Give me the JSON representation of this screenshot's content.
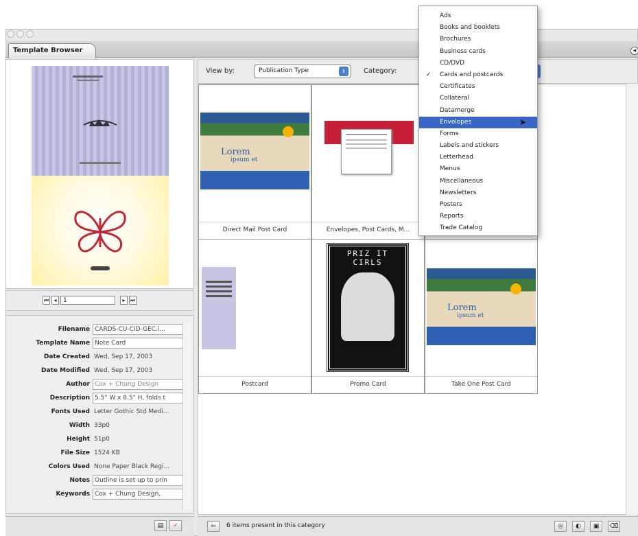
{
  "window": {
    "tab_title": "Template Browser"
  },
  "toolbar": {
    "view_by_label": "View by:",
    "view_by_value": "Publication Type",
    "category_label": "Category:"
  },
  "category_menu": {
    "items": [
      {
        "label": "Ads"
      },
      {
        "label": "Books and booklets"
      },
      {
        "label": "Brochures"
      },
      {
        "label": "Business cards"
      },
      {
        "label": "CD/DVD"
      },
      {
        "label": "Cards and postcards",
        "checked": true
      },
      {
        "label": "Certificates"
      },
      {
        "label": "Collateral"
      },
      {
        "label": "Datamerge"
      },
      {
        "label": "Envelopes",
        "highlighted": true
      },
      {
        "label": "Forms"
      },
      {
        "label": "Labels and stickers"
      },
      {
        "label": "Letterhead"
      },
      {
        "label": "Menus"
      },
      {
        "label": "Miscellaneous"
      },
      {
        "label": "Newsletters"
      },
      {
        "label": "Posters"
      },
      {
        "label": "Reports"
      },
      {
        "label": "Trade Catalog"
      }
    ],
    "check_glyph": "✓",
    "highlight_color": "#3966c6"
  },
  "thumbnails": [
    {
      "caption": "Direct Mail Post Card"
    },
    {
      "caption": "Envelopes, Post Cards, M..."
    },
    {
      "caption": ""
    },
    {
      "caption": "Postcard"
    },
    {
      "caption": "Promo Card"
    },
    {
      "caption": "Take One Post Card"
    }
  ],
  "preview_art": {
    "lorem_line1": "Lorem",
    "lorem_line2": "ipsum et",
    "promo_text": "PRIZ IT CIRLS"
  },
  "pager": {
    "page_value": "1"
  },
  "properties": {
    "filename_label": "Filename",
    "filename_value": "CARDS-CU-CID-GEC.i...",
    "template_name_label": "Template Name",
    "template_name_value": "Note Card",
    "date_created_label": "Date Created",
    "date_created_value": "Wed, Sep 17, 2003",
    "date_modified_label": "Date Modified",
    "date_modified_value": "Wed, Sep 17, 2003",
    "author_label": "Author",
    "author_value": "Cox + Chung Design",
    "description_label": "Description",
    "description_value": "5.5\" W x 8.5\" H, folds t",
    "fonts_used_label": "Fonts Used",
    "fonts_used_value": "Letter Gothic Std Medi...",
    "width_label": "Width",
    "width_value": "33p0",
    "height_label": "Height",
    "height_value": "51p0",
    "file_size_label": "File Size",
    "file_size_value": "1524 KB",
    "colors_used_label": "Colors Used",
    "colors_used_value": "None Paper Black Regi...",
    "notes_label": "Notes",
    "notes_value": "Outline is set up to prin",
    "keywords_label": "Keywords",
    "keywords_value": "Cox + Chung Design, "
  },
  "status": {
    "message": "6 items present in this category"
  }
}
